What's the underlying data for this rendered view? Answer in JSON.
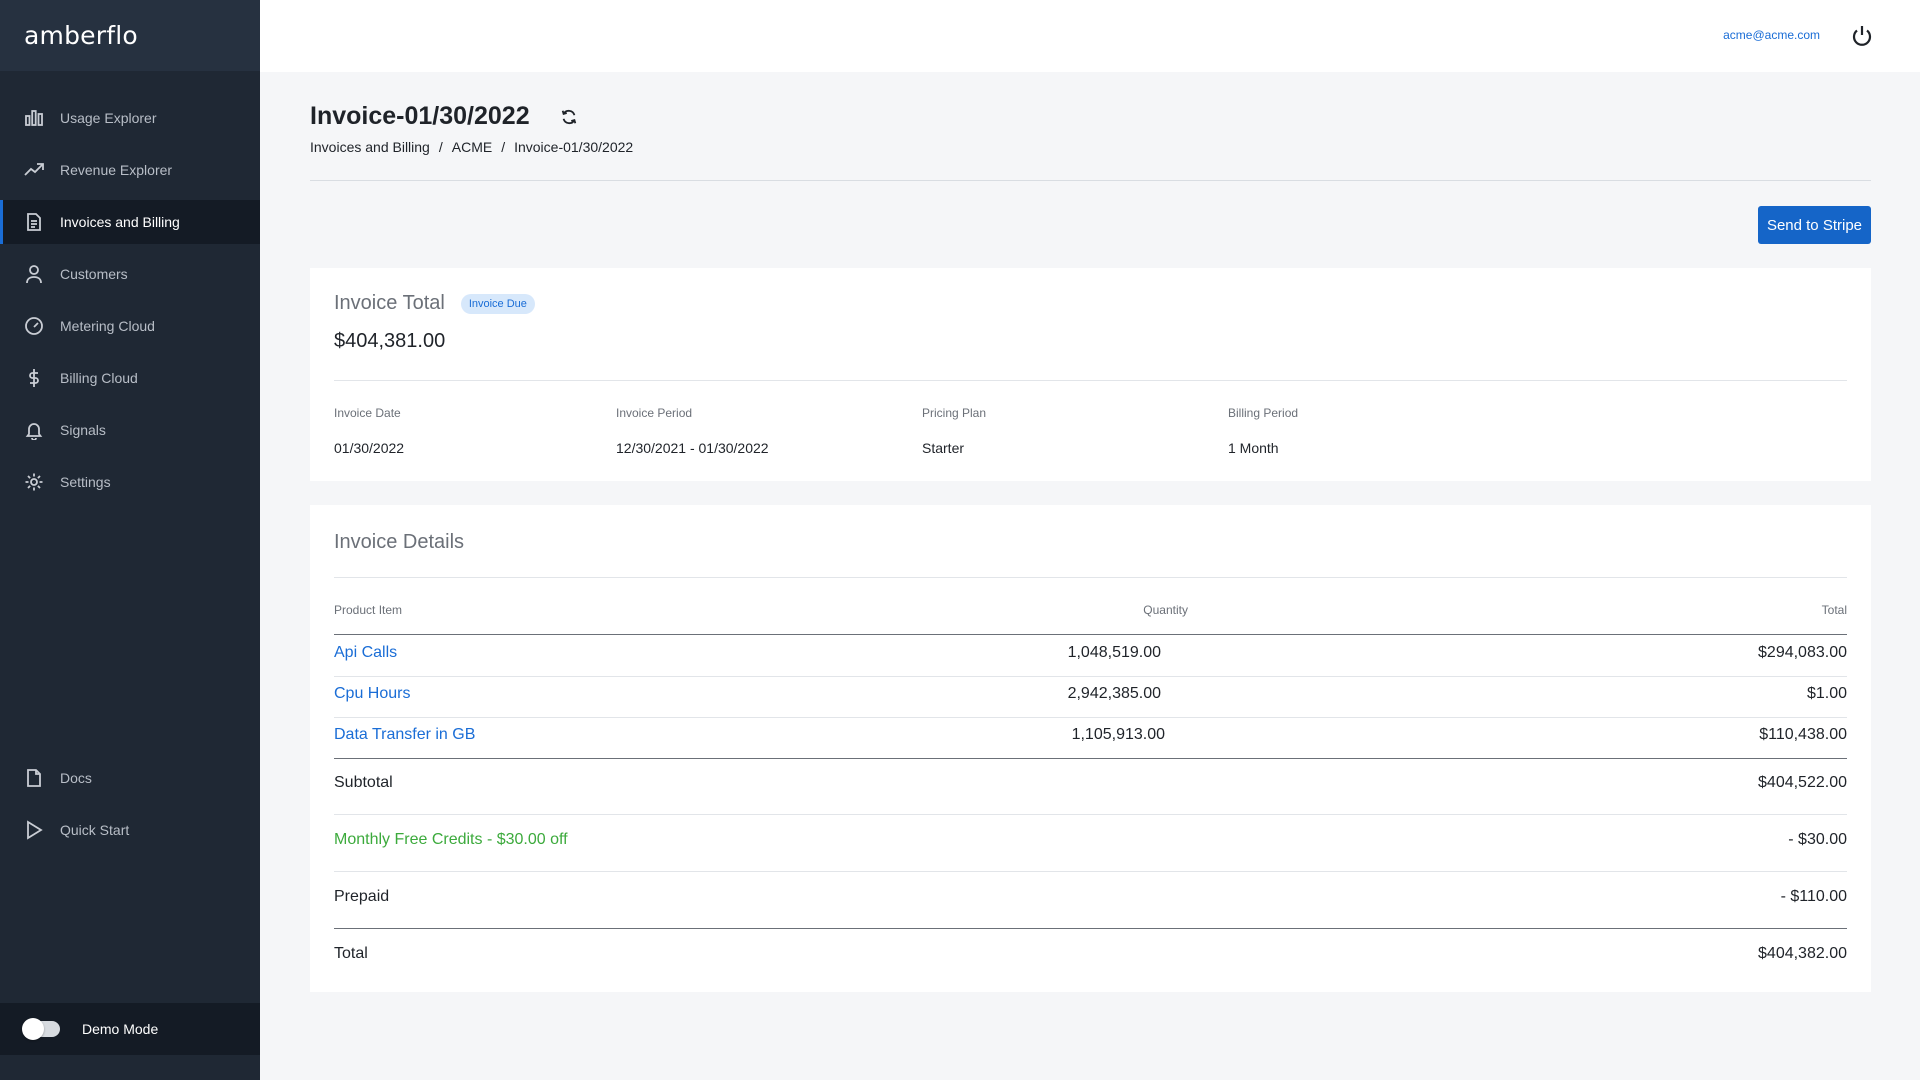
{
  "app": {
    "logo": "amberflo"
  },
  "sidebar": {
    "items": [
      {
        "label": "Usage Explorer",
        "icon": "bar-chart-icon"
      },
      {
        "label": "Revenue Explorer",
        "icon": "trending-up-icon"
      },
      {
        "label": "Invoices and Billing",
        "icon": "document-icon",
        "active": true
      },
      {
        "label": "Customers",
        "icon": "user-icon"
      },
      {
        "label": "Metering Cloud",
        "icon": "gauge-icon"
      },
      {
        "label": "Billing Cloud",
        "icon": "dollar-icon"
      },
      {
        "label": "Signals",
        "icon": "bell-icon"
      },
      {
        "label": "Settings",
        "icon": "gear-icon"
      }
    ],
    "bottom_items": [
      {
        "label": "Docs",
        "icon": "file-icon"
      },
      {
        "label": "Quick Start",
        "icon": "play-icon"
      }
    ],
    "demo_mode_label": "Demo Mode"
  },
  "header": {
    "user_email": "acme@acme.com"
  },
  "page": {
    "title": "Invoice-01/30/2022",
    "breadcrumb": [
      "Invoices and Billing",
      "ACME",
      "Invoice-01/30/2022"
    ],
    "breadcrumb_sep": "/",
    "send_button": "Send to Stripe"
  },
  "summary": {
    "total_label": "Invoice Total",
    "status_badge": "Invoice Due",
    "total_amount": "$404,381.00",
    "invoice_date_label": "Invoice Date",
    "invoice_date": "01/30/2022",
    "invoice_period_label": "Invoice Period",
    "invoice_period": "12/30/2021 - 01/30/2022",
    "pricing_plan_label": "Pricing Plan",
    "pricing_plan": "Starter",
    "billing_period_label": "Billing Period",
    "billing_period": "1 Month"
  },
  "details": {
    "title": "Invoice Details",
    "columns": {
      "product": "Product Item",
      "quantity": "Quantity",
      "total": "Total"
    },
    "rows": [
      {
        "product": "Api Calls",
        "quantity": "1,048,519.00",
        "total": "$294,083.00"
      },
      {
        "product": "Cpu Hours",
        "quantity": "2,942,385.00",
        "total": "$1.00"
      },
      {
        "product": "Data Transfer in GB",
        "quantity": "1,105,913.00",
        "total": "$110,438.00"
      }
    ],
    "subtotal_label": "Subtotal",
    "subtotal": "$404,522.00",
    "credits_label": "Monthly Free Credits - $30.00 off",
    "credits": "- $30.00",
    "prepaid_label": "Prepaid",
    "prepaid": "- $110.00",
    "total_label": "Total",
    "total": "$404,382.00"
  },
  "colors": {
    "accent": "#1a6dd6",
    "sidebar_bg": "#1f2834",
    "credit_green": "#3caa3c"
  }
}
